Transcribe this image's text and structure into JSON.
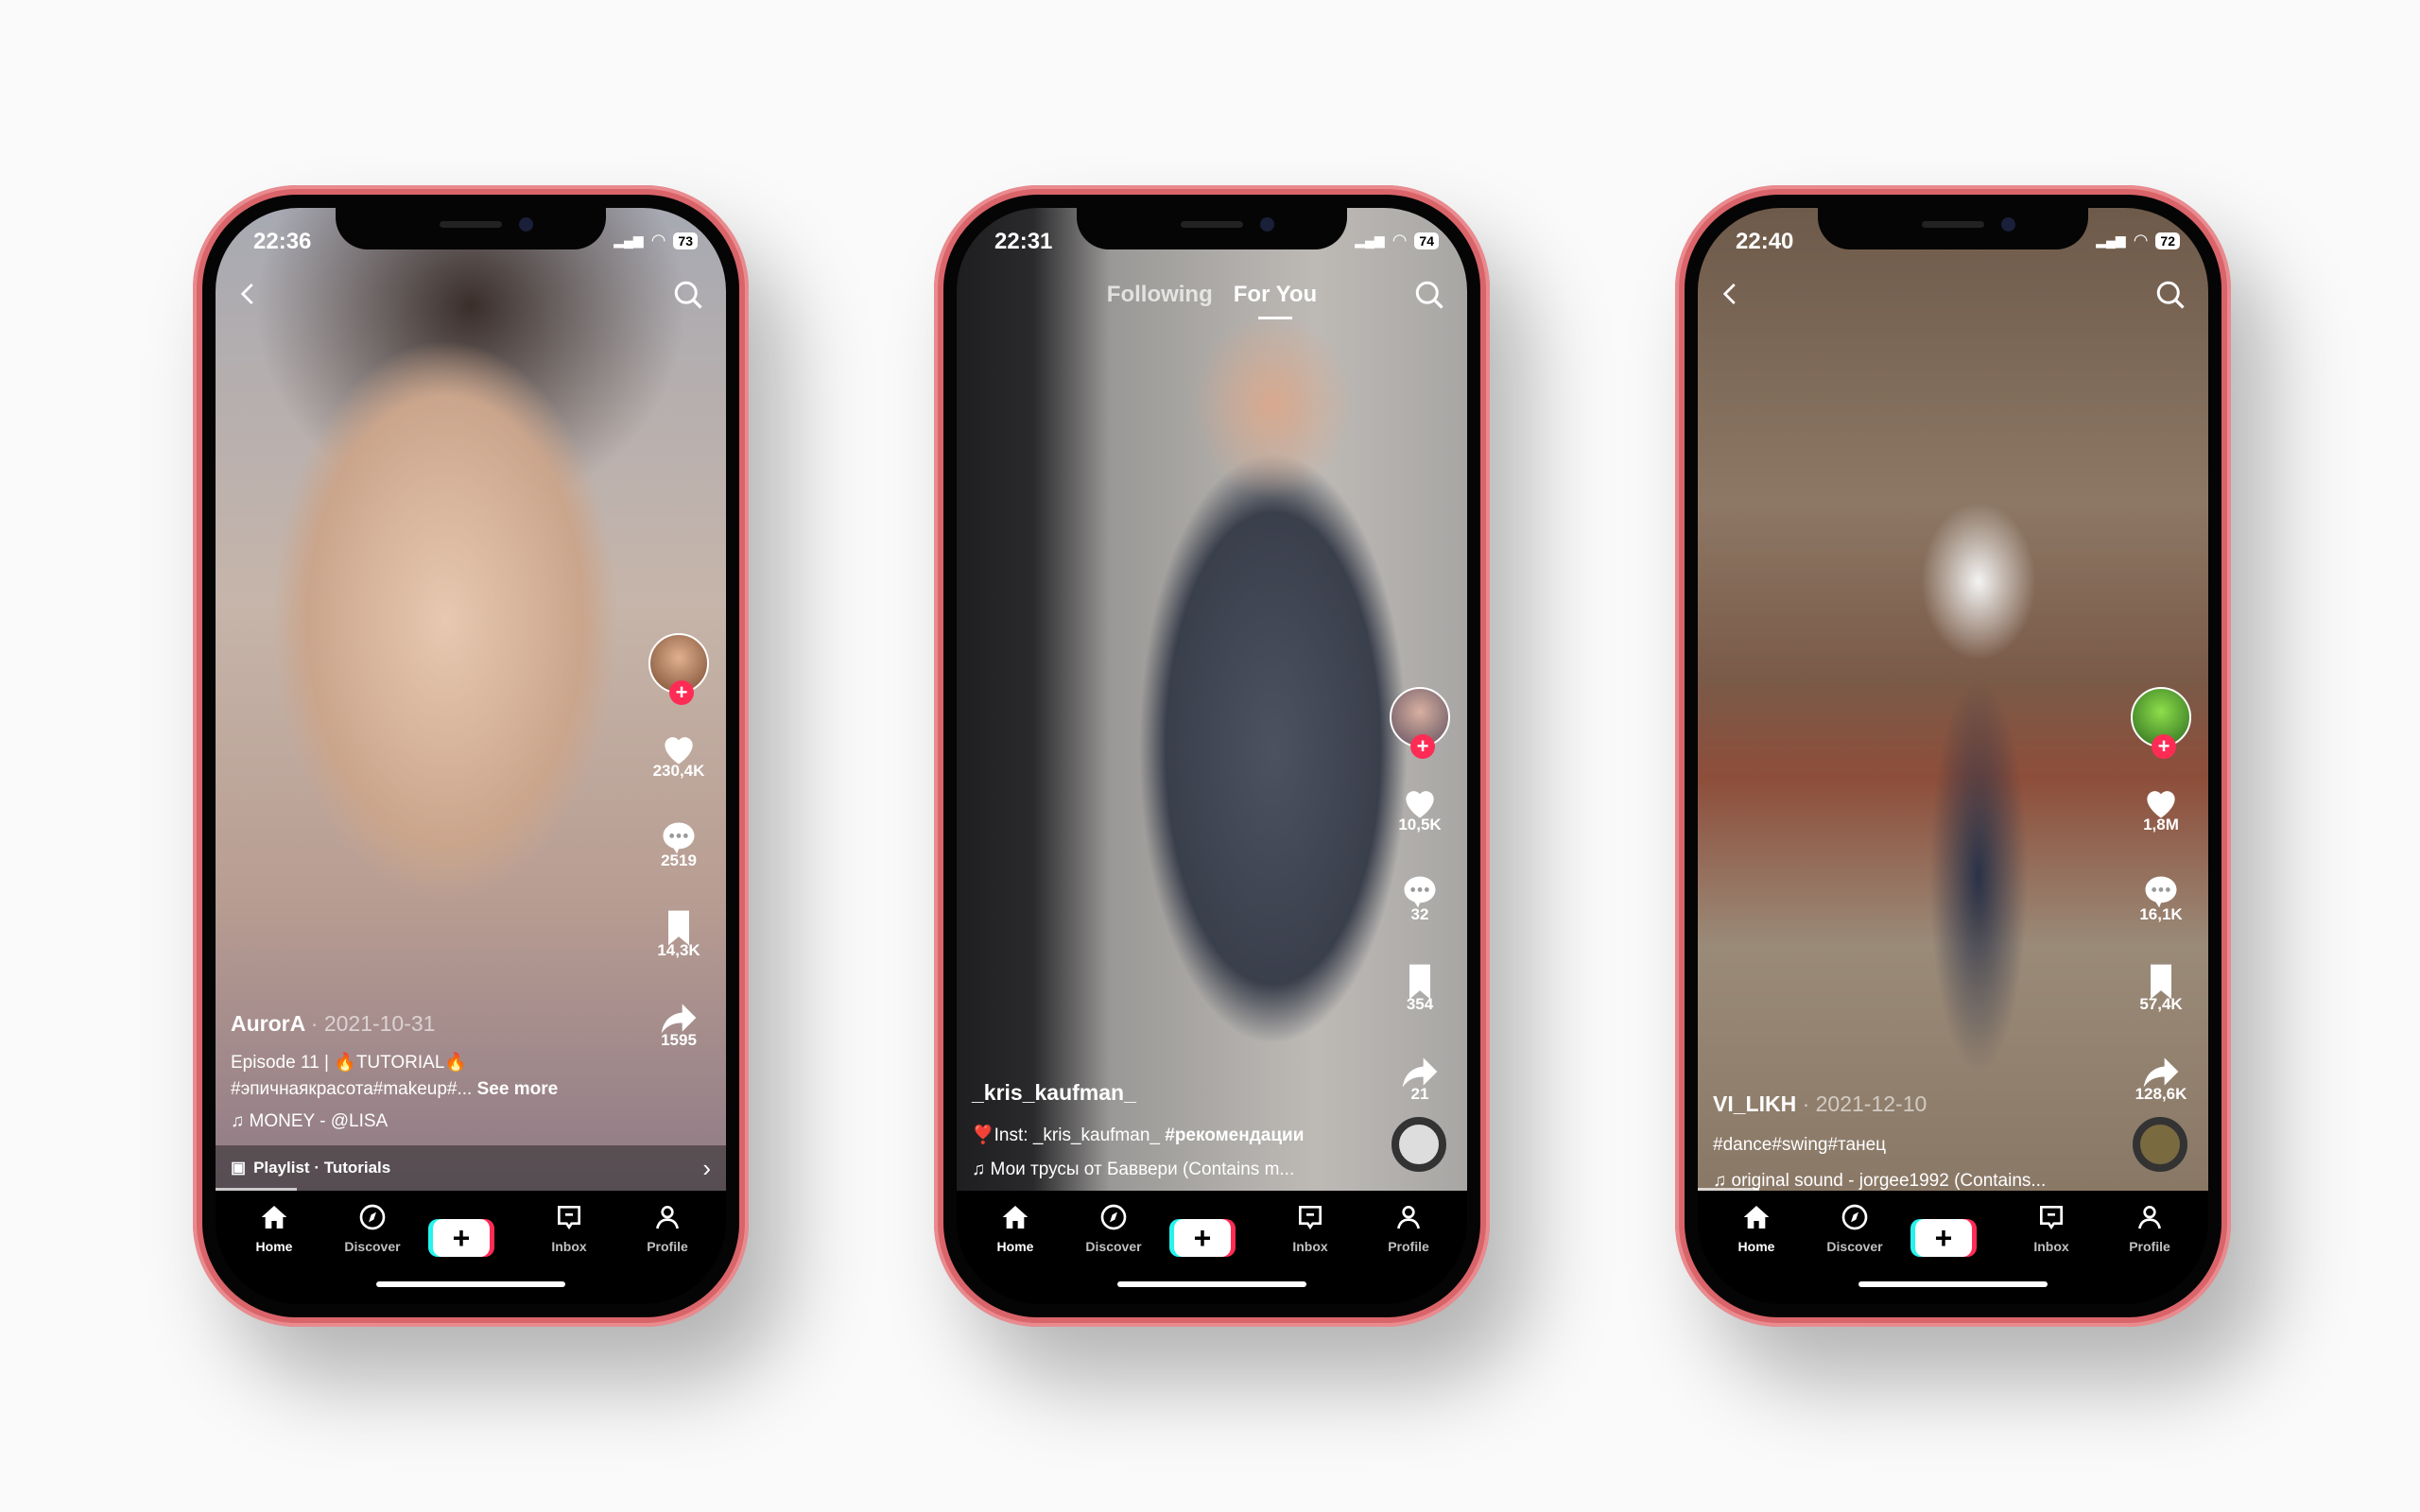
{
  "colors": {
    "accent": "#fe2c55",
    "cyan": "#25f4ee",
    "frame": "#d9646a"
  },
  "nav": {
    "items": [
      {
        "label": "Home",
        "icon": "home-icon"
      },
      {
        "label": "Discover",
        "icon": "compass-icon"
      },
      {
        "label": "Create",
        "icon": "plus-icon"
      },
      {
        "label": "Inbox",
        "icon": "inbox-icon"
      },
      {
        "label": "Profile",
        "icon": "person-icon"
      }
    ]
  },
  "phones": [
    {
      "time": "22:36",
      "battery": "73",
      "top_mode": "back",
      "username": "AurorA",
      "date": "· 2021-10-31",
      "caption": "Episode 11 | 🔥TUTORIAL🔥",
      "hashtags": "#эпичнаякрасота#makeup#...",
      "see_more": "See more",
      "music": "MONEY - @LISA",
      "playlist": "Playlist · Tutorials",
      "likes": "230,4K",
      "comments": "2519",
      "saves": "14,3K",
      "shares": "1595"
    },
    {
      "time": "22:31",
      "battery": "74",
      "top_mode": "tabs",
      "tabs": {
        "following": "Following",
        "for_you": "For You"
      },
      "username": "_kris_kaufman_",
      "caption": "❣️Inst: _kris_kaufman_",
      "caption_tag": "#рекомендации",
      "music": "Мои трусы от Баввери (Contains m...",
      "likes": "10,5K",
      "comments": "32",
      "saves": "354",
      "shares": "21"
    },
    {
      "time": "22:40",
      "battery": "72",
      "top_mode": "back",
      "username": "VI_LIKH",
      "date": "· 2021-12-10",
      "caption": "#dance#swing#танец",
      "music": "original sound - jorgee1992 (Contains...",
      "likes": "1,8M",
      "comments": "16,1K",
      "saves": "57,4K",
      "shares": "128,6K"
    }
  ]
}
